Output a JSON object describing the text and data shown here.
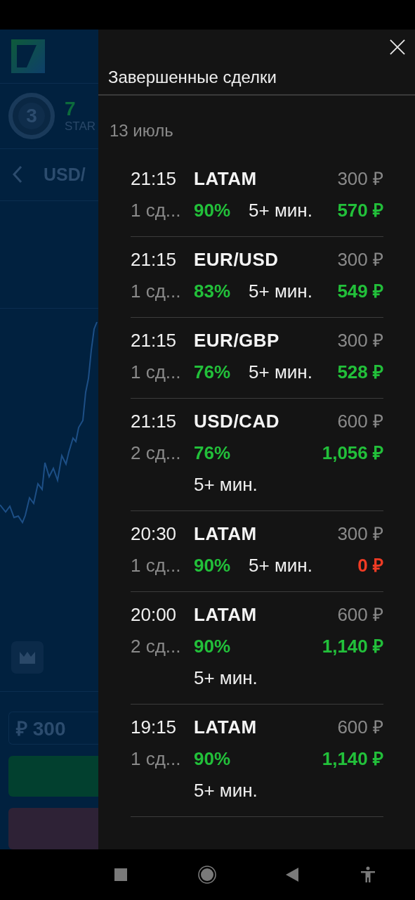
{
  "background": {
    "level_badge": "3",
    "balance": "7",
    "balance_label": "STAR",
    "asset": "USD/",
    "amount": "₽ 300"
  },
  "drawer": {
    "title": "Завершенные сделки",
    "date": "13 июль",
    "trades": [
      {
        "time": "21:15",
        "asset": "LATAM",
        "amount": "300 ₽",
        "count": "1 сд...",
        "percent": "90%",
        "duration": "5+ мин.",
        "payout": "570 ₽",
        "color": "#22c03a"
      },
      {
        "time": "21:15",
        "asset": "EUR/USD",
        "amount": "300 ₽",
        "count": "1 сд...",
        "percent": "83%",
        "duration": "5+ мин.",
        "payout": "549 ₽",
        "color": "#22c03a"
      },
      {
        "time": "21:15",
        "asset": "EUR/GBP",
        "amount": "300 ₽",
        "count": "1 сд...",
        "percent": "76%",
        "duration": "5+ мин.",
        "payout": "528 ₽",
        "color": "#22c03a"
      },
      {
        "time": "21:15",
        "asset": "USD/CAD",
        "amount": "600 ₽",
        "count": "2 сд...",
        "percent": "76%",
        "duration": "5+ мин.",
        "payout": "1,056 ₽",
        "color": "#22c03a"
      },
      {
        "time": "20:30",
        "asset": "LATAM",
        "amount": "300 ₽",
        "count": "1 сд...",
        "percent": "90%",
        "duration": "5+ мин.",
        "payout": "0 ₽",
        "color": "#ef3b24"
      },
      {
        "time": "20:00",
        "asset": "LATAM",
        "amount": "600 ₽",
        "count": "2 сд...",
        "percent": "90%",
        "duration": "5+ мин.",
        "payout": "1,140 ₽",
        "color": "#22c03a"
      },
      {
        "time": "19:15",
        "asset": "LATAM",
        "amount": "600 ₽",
        "count": "1 сд...",
        "percent": "90%",
        "duration": "5+ мин.",
        "payout": "1,140 ₽",
        "color": "#22c03a"
      }
    ]
  }
}
